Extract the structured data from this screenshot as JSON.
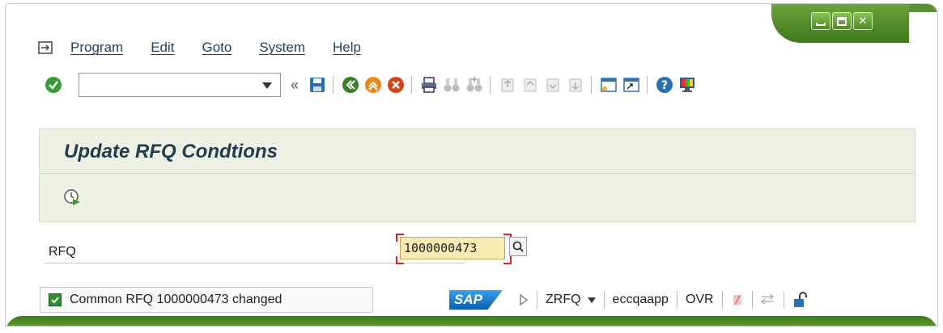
{
  "menubar": {
    "items": [
      {
        "label": "Program"
      },
      {
        "label": "Edit"
      },
      {
        "label": "Goto"
      },
      {
        "label": "System"
      },
      {
        "label": "Help"
      }
    ]
  },
  "toolbar": {
    "command_value": "",
    "collapse_label": "«"
  },
  "screen": {
    "title": "Update RFQ Condtions"
  },
  "form": {
    "rfq_label": "RFQ",
    "rfq_value": "1000000473"
  },
  "status": {
    "message": "Common RFQ 1000000473 changed",
    "sap_logo": "SAP",
    "transaction": "ZRFQ",
    "server": "eccqaapp",
    "mode": "OVR"
  },
  "colors": {
    "sap_green": "#4f8a25",
    "header_bg": "#ecf1e3",
    "input_highlight": "#f8eab2"
  }
}
